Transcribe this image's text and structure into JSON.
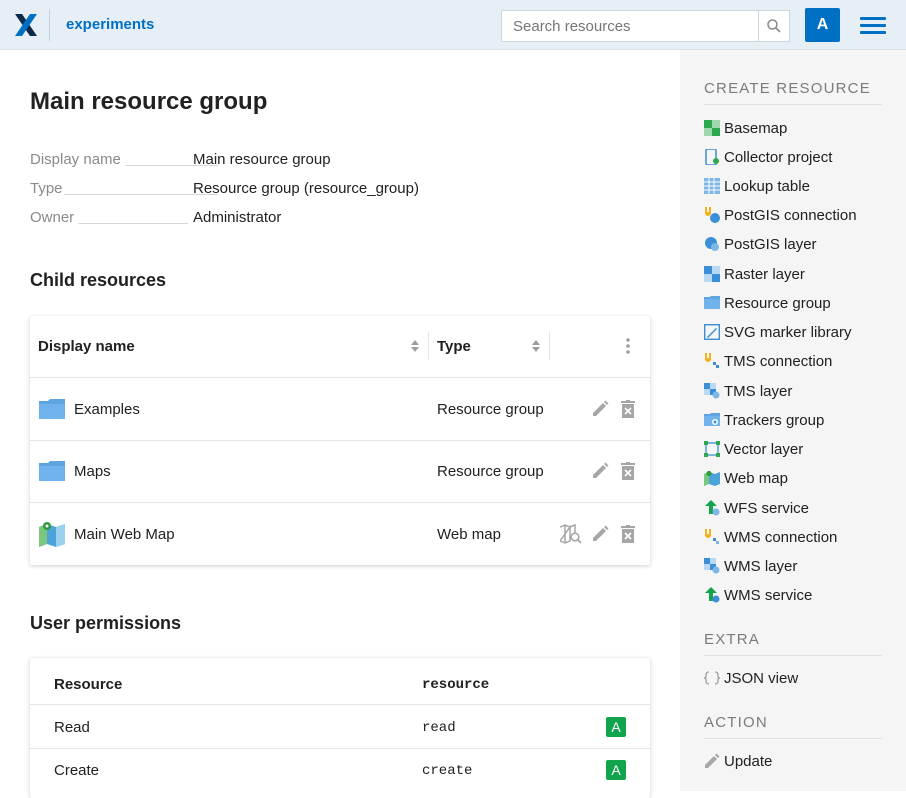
{
  "header": {
    "app_title": "experiments",
    "search_placeholder": "Search resources",
    "avatar_letter": "A"
  },
  "page": {
    "title": "Main resource group",
    "info": [
      {
        "key": "Display name",
        "value": "Main resource group"
      },
      {
        "key": "Type",
        "value": "Resource group (resource_group)"
      },
      {
        "key": "Owner",
        "value": "Administrator"
      }
    ]
  },
  "children": {
    "section_title": "Child resources",
    "col_display_name": "Display name",
    "col_type": "Type",
    "rows": [
      {
        "name": "Examples",
        "type": "Resource group",
        "icon": "folder-icon"
      },
      {
        "name": "Maps",
        "type": "Resource group",
        "icon": "folder-icon"
      },
      {
        "name": "Main Web Map",
        "type": "Web map",
        "icon": "webmap-icon"
      }
    ]
  },
  "permissions": {
    "section_title": "User permissions",
    "col_resource": "Resource",
    "col_code": "resource",
    "rows": [
      {
        "label": "Read",
        "code": "read",
        "badge": "A"
      },
      {
        "label": "Create",
        "code": "create",
        "badge": "A"
      }
    ]
  },
  "sidebar": {
    "create_title": "CREATE RESOURCE",
    "create_items": [
      {
        "label": "Basemap",
        "icon": "basemap-icon"
      },
      {
        "label": "Collector project",
        "icon": "collector-icon"
      },
      {
        "label": "Lookup table",
        "icon": "lookup-table-icon"
      },
      {
        "label": "PostGIS connection",
        "icon": "postgis-connection-icon"
      },
      {
        "label": "PostGIS layer",
        "icon": "postgis-layer-icon"
      },
      {
        "label": "Raster layer",
        "icon": "raster-layer-icon"
      },
      {
        "label": "Resource group",
        "icon": "folder-icon"
      },
      {
        "label": "SVG marker library",
        "icon": "svg-marker-icon"
      },
      {
        "label": "TMS connection",
        "icon": "tms-connection-icon"
      },
      {
        "label": "TMS layer",
        "icon": "tms-layer-icon"
      },
      {
        "label": "Trackers group",
        "icon": "trackers-group-icon"
      },
      {
        "label": "Vector layer",
        "icon": "vector-layer-icon"
      },
      {
        "label": "Web map",
        "icon": "webmap-icon"
      },
      {
        "label": "WFS service",
        "icon": "wfs-service-icon"
      },
      {
        "label": "WMS connection",
        "icon": "wms-connection-icon"
      },
      {
        "label": "WMS layer",
        "icon": "wms-layer-icon"
      },
      {
        "label": "WMS service",
        "icon": "wms-service-icon"
      }
    ],
    "extra_title": "EXTRA",
    "extra_items": [
      {
        "label": "JSON view",
        "icon": "json-icon"
      }
    ],
    "action_title": "ACTION",
    "action_items": [
      {
        "label": "Update",
        "icon": "pencil-icon"
      }
    ]
  },
  "colors": {
    "accent": "#0070c5",
    "badge_green": "#12a34d"
  }
}
